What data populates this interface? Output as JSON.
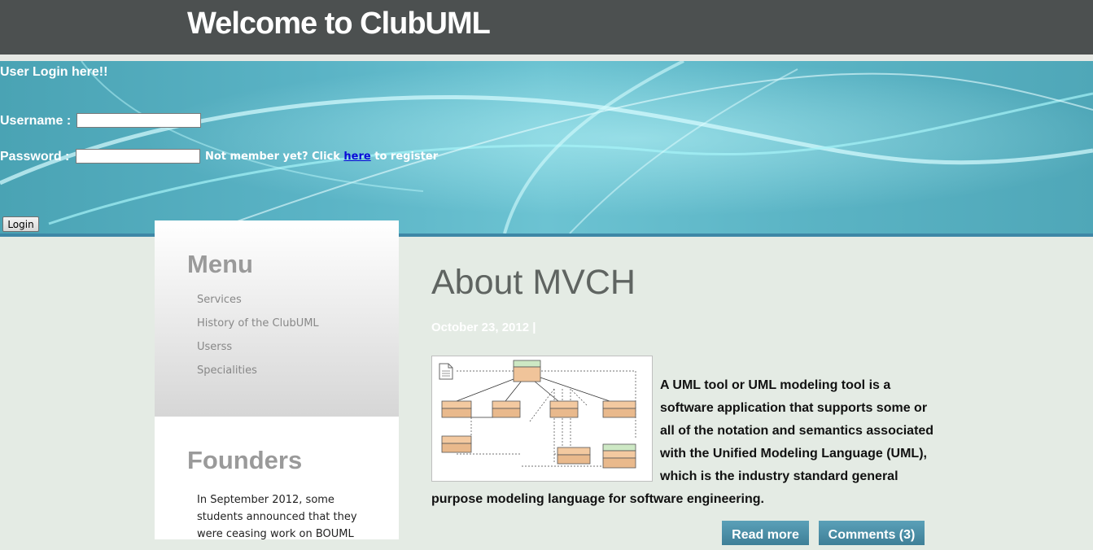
{
  "header": {
    "title": "Welcome to ClubUML"
  },
  "login": {
    "heading": "User Login here!!",
    "username_label": "Username :",
    "password_label": "Password :",
    "register_prefix": "Not member yet? Click ",
    "register_link": "here",
    "register_suffix": " to register",
    "login_button": "Login"
  },
  "sidebar": {
    "menu_title": "Menu",
    "menu_items": [
      "Services",
      "History of the ClubUML",
      "Userss",
      "Specialities"
    ],
    "founders_title": "Founders",
    "founders_text": "In September 2012, some students announced that they were ceasing work on BOUML"
  },
  "post": {
    "title": "About MVCH",
    "date": "October 23, 2012  |",
    "body": "A UML tool or UML modeling tool is a software application that supports some or all of the notation and semantics associated with the Unified Modeling Language (UML), which is the industry standard general purpose modeling language for software engineering.",
    "read_more": "Read more",
    "comments": "Comments (3)"
  },
  "colors": {
    "header_bg": "#4c5050",
    "banner": "#5bb4c6",
    "page_bg": "#e4ebe4",
    "button_blue": "#3f7f97",
    "link": "#0a0ad8"
  },
  "icons": {
    "diagram": "uml-class-diagram-image",
    "document": "document-icon"
  }
}
